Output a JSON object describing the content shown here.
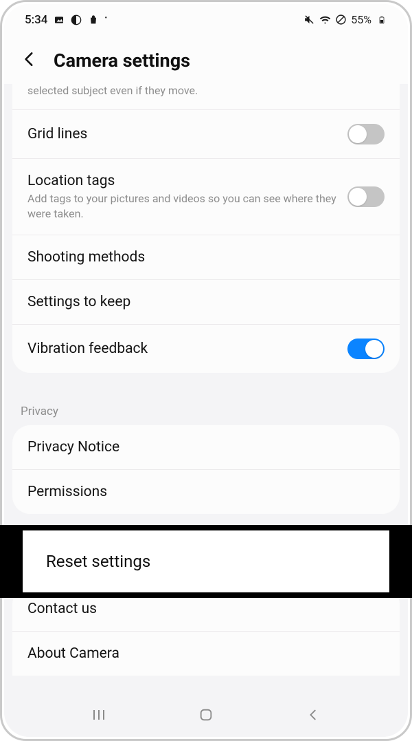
{
  "status": {
    "time": "5:34",
    "battery_text": "55%"
  },
  "header": {
    "title": "Camera settings"
  },
  "truncated_top_subtitle": "selected subject even if they move.",
  "rows": {
    "grid_lines": {
      "title": "Grid lines"
    },
    "location_tags": {
      "title": "Location tags",
      "sub": "Add tags to your pictures and videos so you can see where they were taken."
    },
    "shooting_methods": {
      "title": "Shooting methods"
    },
    "settings_to_keep": {
      "title": "Settings to keep"
    },
    "vibration_feedback": {
      "title": "Vibration feedback"
    }
  },
  "section_privacy": "Privacy",
  "privacy_rows": {
    "privacy_notice": {
      "title": "Privacy Notice"
    },
    "permissions": {
      "title": "Permissions"
    }
  },
  "callout": {
    "title": "Reset settings"
  },
  "bottom_rows": {
    "contact_us": {
      "title": "Contact us"
    },
    "about_camera": {
      "title": "About Camera"
    }
  }
}
